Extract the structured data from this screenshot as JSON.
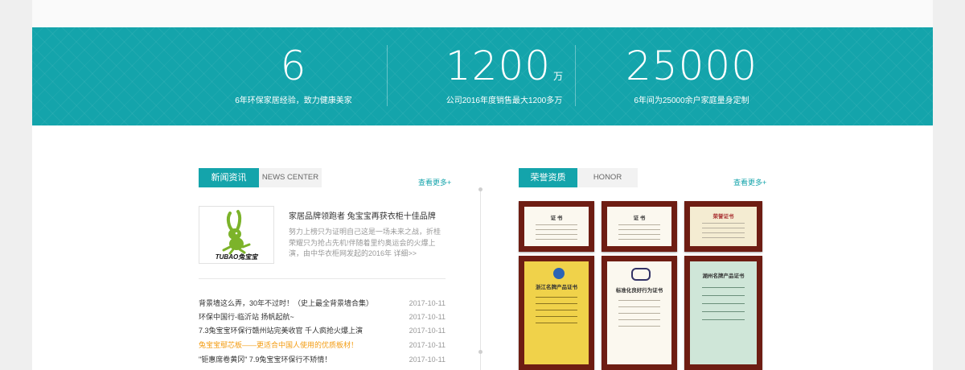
{
  "stats": [
    {
      "number": "6",
      "unit": "",
      "caption": "6年环保家居经验，致力健康美家"
    },
    {
      "number": "1200",
      "unit": "万",
      "caption": "公司2016年度销售最大1200多万"
    },
    {
      "number": "25000",
      "unit": "",
      "caption": "6年间为25000余户家庭量身定制"
    }
  ],
  "news": {
    "tab_label": "新闻资讯",
    "tab_en": "NEWS CENTER",
    "more": "查看更多+",
    "logo_text": "TUBAO兔宝宝",
    "featured_title": "家居品牌领跑者 兔宝宝再获衣柜十佳品牌",
    "featured_desc": "努力上榜只为证明自己这是一场未来之战，折桂荣耀只为抢占先机!伴随着里约奥运会的火爆上演，由中华衣柜网发起的2016年",
    "featured_link": "详细>>",
    "items": [
      {
        "title": "背景墙这么弄，30年不过时！（史上最全背景墙合集）",
        "date": "2017-10-11",
        "highlight": false
      },
      {
        "title": "环保中国行-临沂站 扬帆起航~",
        "date": "2017-10-11",
        "highlight": false
      },
      {
        "title": "7.3兔宝宝环保行赣州站完美收官 千人疯抢火爆上演",
        "date": "2017-10-11",
        "highlight": false
      },
      {
        "title": "兔宝宝鄢芯板——更适合中国人使用的优质板材！",
        "date": "2017-10-11",
        "highlight": true
      },
      {
        "title": "\"钜惠席卷黄冈\" 7.9兔宝宝环保行不矫情！",
        "date": "2017-10-11",
        "highlight": false
      }
    ]
  },
  "honor": {
    "tab_label": "荣誉资质",
    "tab_en": "HONOR",
    "more": "查看更多+",
    "certs": [
      {
        "title": "证 书"
      },
      {
        "title": "证 书"
      },
      {
        "title": "荣誉证书"
      },
      {
        "title": "浙江名牌产品证书"
      },
      {
        "title": "标准化良好行为证书"
      },
      {
        "title": "湖州名牌产品证书"
      }
    ]
  },
  "colors": {
    "accent": "#14a4ab",
    "highlight": "#f39c12"
  }
}
